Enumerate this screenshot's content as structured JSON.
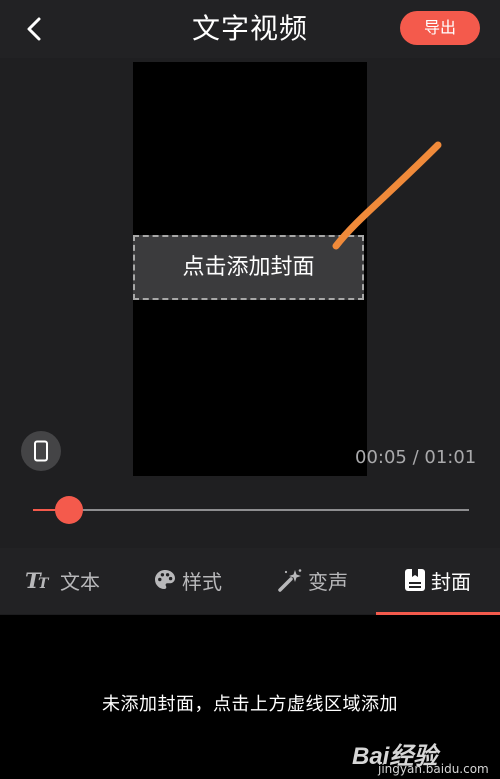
{
  "header": {
    "title": "文字视频",
    "export_label": "导出"
  },
  "preview": {
    "cover_box_label": "点击添加封面",
    "time_readout": "00:05 / 01:01",
    "progress": 0.083
  },
  "tabs": [
    {
      "label": "文本",
      "icon": "text-size-icon",
      "active": false
    },
    {
      "label": "样式",
      "icon": "palette-icon",
      "active": false
    },
    {
      "label": "变声",
      "icon": "magic-wand-icon",
      "active": false
    },
    {
      "label": "封面",
      "icon": "cover-image-icon",
      "active": true
    }
  ],
  "hint": "未添加封面，点击上方虚线区域添加",
  "watermark": {
    "logo": "Bai经验",
    "url": "jingyan.baidu.com"
  },
  "colors": {
    "accent": "#f45a4c",
    "annotation": "#f08a3a",
    "background": "#1c1c1e"
  }
}
